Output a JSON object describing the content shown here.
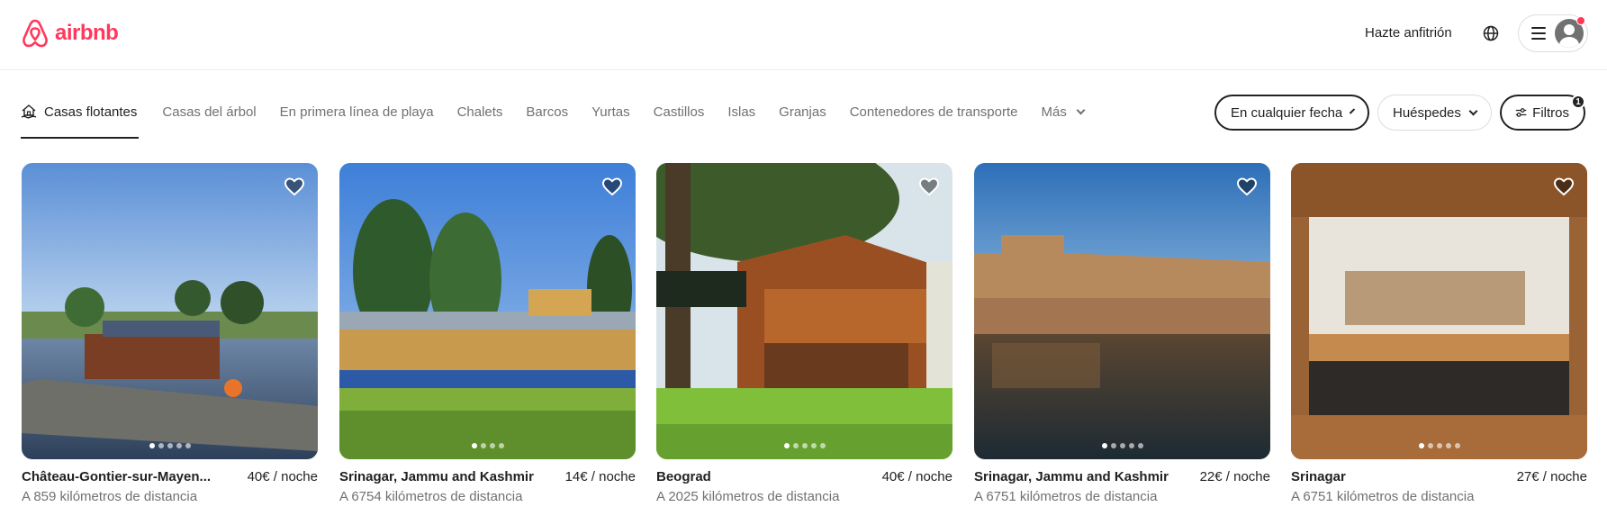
{
  "brand": {
    "name": "airbnb",
    "color": "#ff385c"
  },
  "header": {
    "host_label": "Hazte anfitrión"
  },
  "categories": [
    {
      "label": "Casas flotantes",
      "active": true
    },
    {
      "label": "Casas del árbol"
    },
    {
      "label": "En primera línea de playa"
    },
    {
      "label": "Chalets"
    },
    {
      "label": "Barcos"
    },
    {
      "label": "Yurtas"
    },
    {
      "label": "Castillos"
    },
    {
      "label": "Islas"
    },
    {
      "label": "Granjas"
    },
    {
      "label": "Contenedores de transporte"
    },
    {
      "label": "Más"
    }
  ],
  "filters": {
    "date_label": "En cualquier fecha",
    "guests_label": "Huéspedes",
    "filters_label": "Filtros",
    "filters_count": "1"
  },
  "listings": [
    {
      "title": "Château-Gontier-sur-Mayen...",
      "price": "40€ / noche",
      "distance": "A 859 kilómetros de distancia"
    },
    {
      "title": "Srinagar, Jammu and Kashmir",
      "price": "14€ / noche",
      "distance": "A 6754 kilómetros de distancia"
    },
    {
      "title": "Beograd",
      "price": "40€ / noche",
      "distance": "A 2025 kilómetros de distancia"
    },
    {
      "title": "Srinagar, Jammu and Kashmir",
      "price": "22€ / noche",
      "distance": "A 6751 kilómetros de distancia"
    },
    {
      "title": "Srinagar",
      "price": "27€ / noche",
      "distance": "A 6751 kilómetros de distancia"
    }
  ]
}
